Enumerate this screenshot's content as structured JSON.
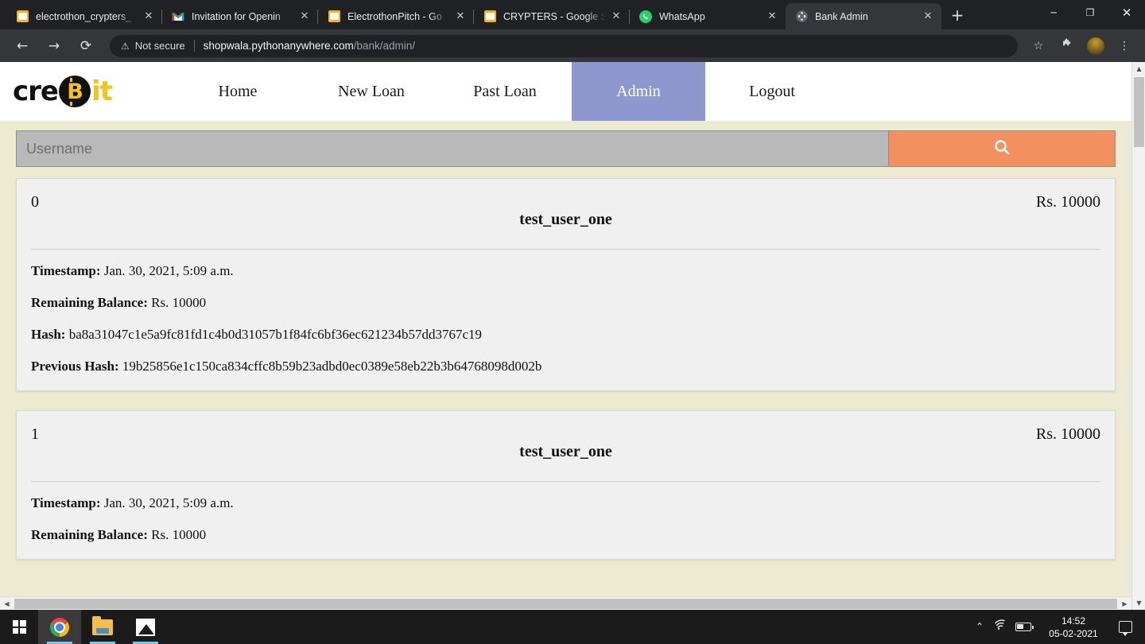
{
  "browser": {
    "tabs": [
      {
        "title": "electrothon_crypters_",
        "icon": "document-icon",
        "active": false
      },
      {
        "title": "Invitation for Openin",
        "icon": "gmail-icon",
        "active": false
      },
      {
        "title": "ElectrothonPitch - Go",
        "icon": "document-icon",
        "active": false
      },
      {
        "title": "CRYPTERS - Google S",
        "icon": "document-icon",
        "active": false
      },
      {
        "title": "WhatsApp",
        "icon": "whatsapp-icon",
        "active": false
      },
      {
        "title": "Bank Admin",
        "icon": "globe-icon",
        "active": true
      }
    ],
    "new_tab_label": "+",
    "close_label": "✕",
    "window_controls": {
      "minimize": "─",
      "maximize": "❐",
      "close": "✕"
    },
    "toolbar": {
      "back": "←",
      "forward": "→",
      "reload": "⟳",
      "security_icon": "warning-triangle-icon",
      "security_text": "Not secure",
      "url_domain": "shopwala.pythonanywhere.com",
      "url_path": "/bank/admin/",
      "bookmark": "☆",
      "extensions": "🧩",
      "menu": "⋮"
    }
  },
  "site": {
    "logo": {
      "part1": "cre",
      "coin": "B",
      "part2": "it"
    },
    "nav": [
      {
        "label": "Home",
        "active": false
      },
      {
        "label": "New Loan",
        "active": false
      },
      {
        "label": "Past Loan",
        "active": false
      },
      {
        "label": "Admin",
        "active": true
      },
      {
        "label": "Logout",
        "active": false
      }
    ],
    "search": {
      "placeholder": "Username",
      "value": "",
      "button_icon": "search-icon"
    },
    "labels": {
      "timestamp": "Timestamp:",
      "remaining_balance": "Remaining Balance:",
      "hash": "Hash:",
      "previous_hash": "Previous Hash:"
    },
    "blocks": [
      {
        "index": "0",
        "amount": "Rs. 10000",
        "user": "test_user_one",
        "timestamp": "Jan. 30, 2021, 5:09 a.m.",
        "remaining_balance": "Rs. 10000",
        "hash": "ba8a31047c1e5a9fc81fd1c4b0d31057b1f84fc6bf36ec621234b57dd3767c19",
        "previous_hash": "19b25856e1c150ca834cffc8b59b23adbd0ec0389e58eb22b3b64768098d002b"
      },
      {
        "index": "1",
        "amount": "Rs. 10000",
        "user": "test_user_one",
        "timestamp": "Jan. 30, 2021, 5:09 a.m.",
        "remaining_balance": "Rs. 10000",
        "hash": "",
        "previous_hash": ""
      }
    ],
    "colors": {
      "page_background": "#ecead1",
      "card_background": "#f0f0f0",
      "nav_active": "#8e98cf",
      "search_button": "#f2915f",
      "search_field": "#b9b9b9",
      "logo_accent": "#f5c21a"
    }
  },
  "taskbar": {
    "start_icon": "windows-logo-icon",
    "apps": [
      {
        "name": "chrome-icon"
      },
      {
        "name": "file-explorer-icon"
      },
      {
        "name": "photos-icon"
      }
    ],
    "tray": {
      "chevron": "⌃",
      "wifi_icon": "wifi-icon",
      "battery_icon": "battery-icon",
      "time": "14:52",
      "date": "05-02-2021",
      "action_center_icon": "speech-bubble-icon"
    }
  },
  "scrollbars": {
    "v_up": "▲",
    "v_down": "▼",
    "h_left": "◀",
    "h_right": "▶"
  }
}
